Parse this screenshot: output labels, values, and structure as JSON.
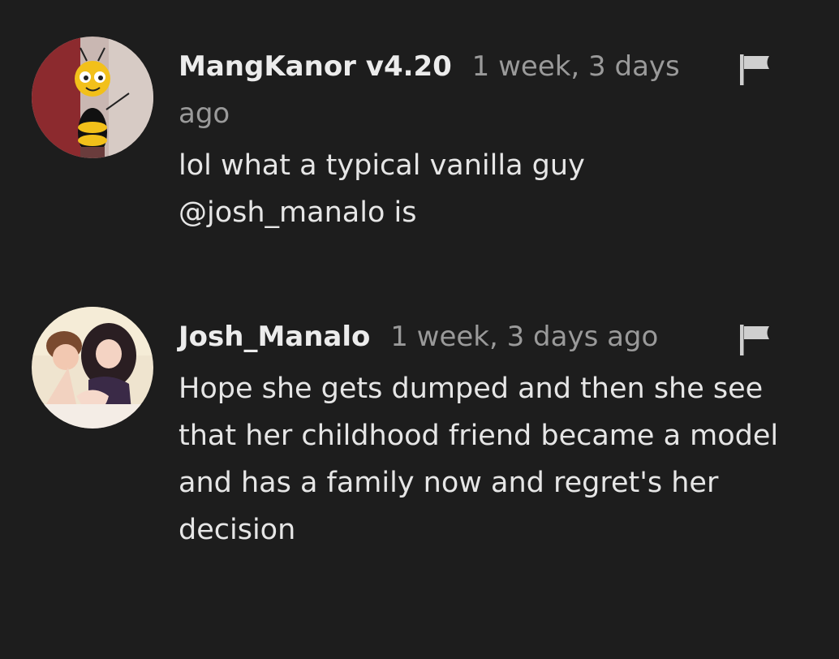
{
  "comments": [
    {
      "username": "MangKanor v4.20",
      "time": "1 week, 3 days ago",
      "text": "lol what a typical vanilla guy @josh_manalo is"
    },
    {
      "username": "Josh_Manalo",
      "time": "1 week, 3 days ago",
      "text": "Hope she gets dumped and then she see that her childhood friend became a model and has a family now and regret's her decision"
    }
  ],
  "colors": {
    "background": "#1d1d1d",
    "username": "#ececec",
    "timestamp": "#9a9a9a",
    "text": "#e6e6e6",
    "flag": "#cfcfcf"
  },
  "icons": [
    "avatar-image",
    "flag-icon"
  ]
}
